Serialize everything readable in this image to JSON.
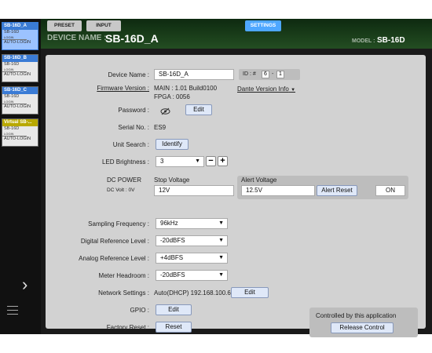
{
  "sidebar": {
    "devices": [
      {
        "name": "SB-16D_A",
        "model": "SB-16D",
        "status": "LOGIN",
        "mode": "AUTO-LOGIN",
        "active": true,
        "head_color": "#3a7bd5"
      },
      {
        "name": "SB-16D_B",
        "model": "SB-16D",
        "status": "LOGIN",
        "mode": "AUTO-LOGIN",
        "active": false,
        "head_color": "#3a7bd5"
      },
      {
        "name": "SB-16D_C",
        "model": "SB-16D",
        "status": "LOGIN",
        "mode": "AUTO-LOGIN",
        "active": false,
        "head_color": "#3a7bd5"
      },
      {
        "name": "Virtual SB-...",
        "model": "SB-16D",
        "status": "LOGIN",
        "mode": "AUTO-LOGIN",
        "active": false,
        "head_color": "#b8a800"
      }
    ],
    "expand_icon": "chevron-right-icon",
    "menu_icon": "hamburger-menu-icon"
  },
  "tabs": {
    "preset": "PRESET",
    "input": "INPUT",
    "settings": "SETTINGS"
  },
  "header": {
    "device_name_label": "DEVICE NAME :",
    "device_name": "SB-16D_A",
    "model_label": "MODEL :",
    "model": "SB-16D"
  },
  "settings": {
    "device_name_label": "Device Name :",
    "device_name_value": "SB-16D_A",
    "id_label": "ID : #",
    "id_1": "6",
    "id_sep": "-",
    "id_2": "1",
    "firmware_label": "Firmware Version :",
    "firmware_main": "MAIN :  1.01 Build0100",
    "firmware_fpga": "FPGA :   0056",
    "dante_label": "Dante Version Info",
    "password_label": "Password :",
    "password_edit": "Edit",
    "serial_label": "Serial No. :",
    "serial_value": "ES9",
    "unit_search_label": "Unit Search :",
    "identify": "Identify",
    "led_label": "LED Brightness :",
    "led_value": "3",
    "led_minus": "−",
    "led_plus": "+",
    "dc_power_label": "DC POWER",
    "dc_volt_label": "DC Volt : 0V",
    "stop_voltage_label": "Stop Voltage",
    "stop_voltage_value": "12V",
    "alert_voltage_label": "Alert Voltage",
    "alert_voltage_value": "12.5V",
    "alert_reset": "Alert Reset",
    "alert_on": "ON",
    "sampling_label": "Sampling Frequency :",
    "sampling_value": "96kHz",
    "digital_ref_label": "Digital Reference Level :",
    "digital_ref_value": "-20dBFS",
    "analog_ref_label": "Analog Reference Level :",
    "analog_ref_value": "+4dBFS",
    "meter_label": "Meter Headroom :",
    "meter_value": "-20dBFS",
    "network_label": "Network Settings :",
    "network_value": "Auto(DHCP) 192.168.100.6",
    "network_edit": "Edit",
    "gpio_label": "GPIO :",
    "gpio_edit": "Edit",
    "factory_label": "Factory Reset :",
    "factory_reset": "Reset",
    "controlled_text": "Controlled by this application",
    "release_control": "Release Control"
  },
  "colors": {
    "accent": "#4ea7ff",
    "header_bg": "#1e4420",
    "panel_bg": "#d2d2d2"
  }
}
